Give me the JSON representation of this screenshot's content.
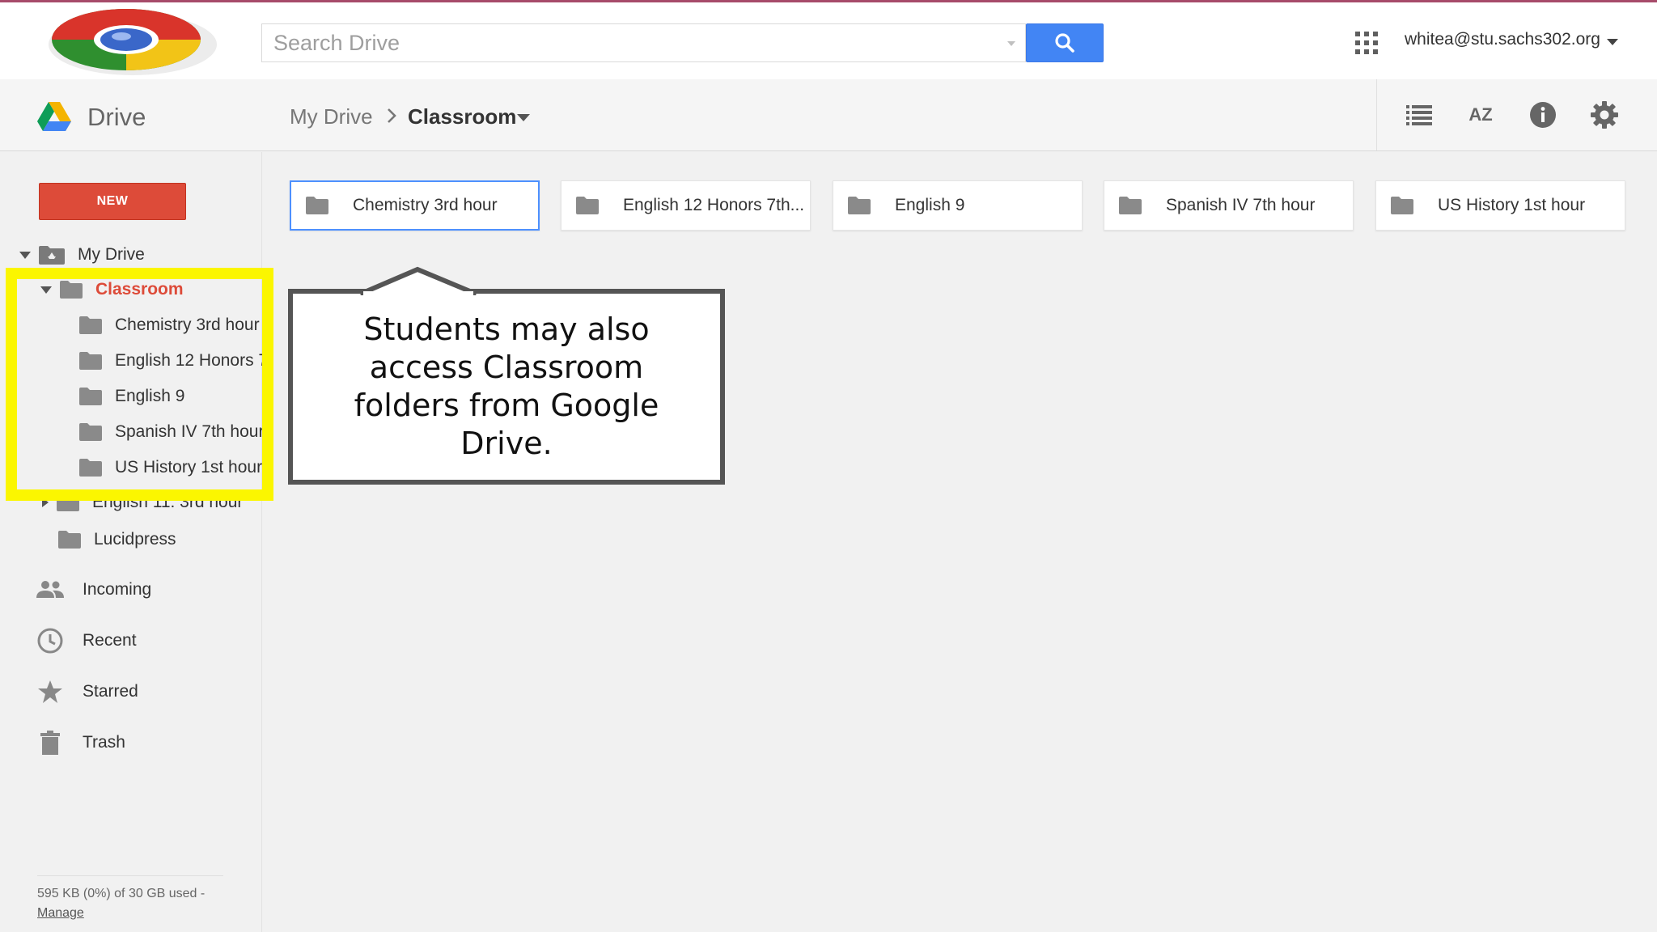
{
  "header": {
    "search_placeholder": "Search Drive",
    "account_email": "whitea@stu.sachs302.org"
  },
  "drivebar": {
    "app_title": "Drive",
    "breadcrumb": {
      "root": "My Drive",
      "current": "Classroom"
    },
    "tools": {
      "sort_label": "AZ"
    }
  },
  "sidebar": {
    "new_button": "NEW",
    "tree": {
      "my_drive": "My Drive",
      "classroom": "Classroom",
      "classroom_children": [
        "Chemistry 3rd hour",
        "English 12 Honors 7",
        "English 9",
        "Spanish IV 7th hour",
        "US History 1st hour"
      ],
      "english11": "English 11: 3rd hour",
      "lucidpress": "Lucidpress"
    },
    "nav": {
      "incoming": "Incoming",
      "recent": "Recent",
      "starred": "Starred",
      "trash": "Trash"
    },
    "storage": {
      "used": "595 KB (0%) of 30 GB used -",
      "manage": "Manage"
    }
  },
  "main": {
    "folders": [
      "Chemistry 3rd hour",
      "English 12 Honors 7th...",
      "English 9",
      "Spanish IV 7th hour",
      "US History 1st hour"
    ]
  },
  "callout": {
    "text": "Students may also access Classroom folders from Google Drive."
  },
  "colors": {
    "new_button": "#dd4b39",
    "search_button": "#4285f4",
    "active_folder_text": "#dd4b39",
    "selection_border": "#4d90fe",
    "highlight": "#fbf600"
  }
}
